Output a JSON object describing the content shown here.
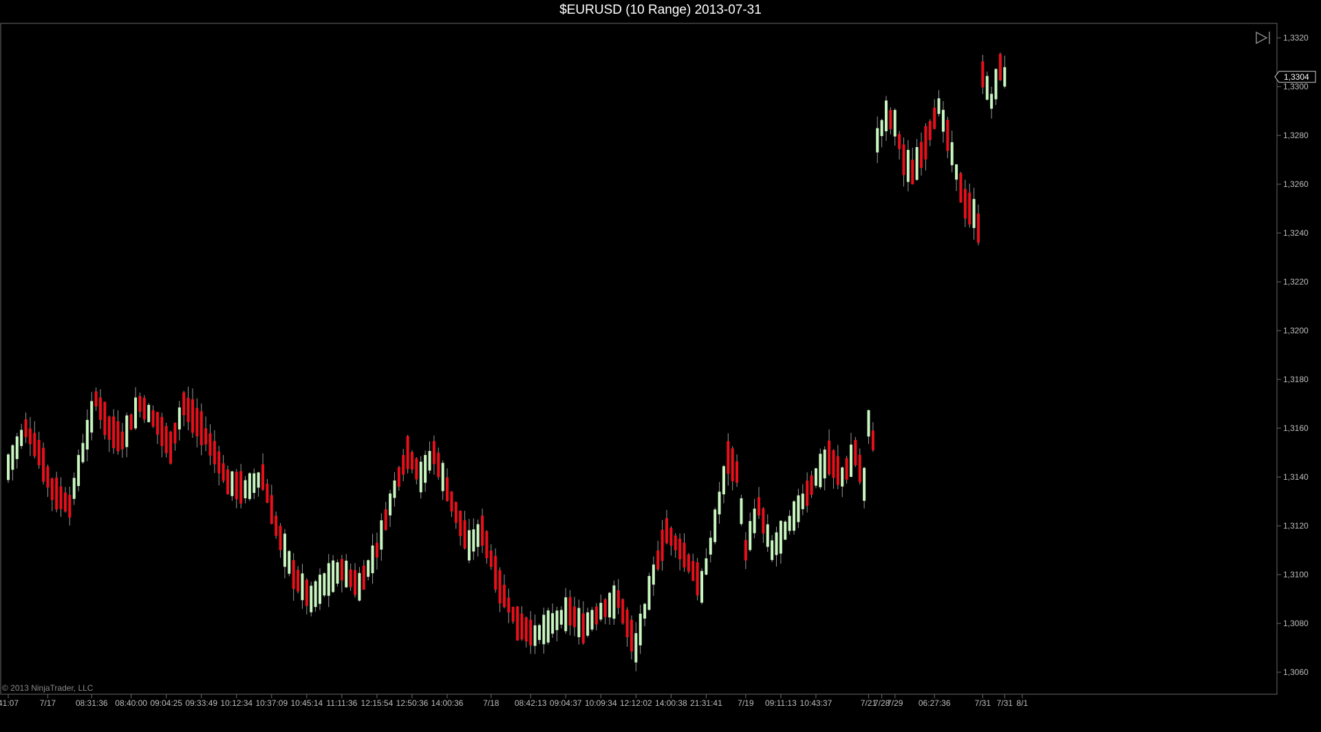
{
  "title": "$EURUSD (10 Range)  2013-07-31",
  "copyright": "© 2013 NinjaTrader, LLC",
  "colors": {
    "background": "#000000",
    "up": "#c8f5c0",
    "down": "#e8101a",
    "wick": "#9a9a9a",
    "axis": "#6a6a6a",
    "text": "#bdbdbd"
  },
  "icons": {
    "scroll_end": "scroll-to-end-icon"
  },
  "chart_data": {
    "type": "candlestick",
    "title": "$EURUSD (10 Range)  2013-07-31",
    "instrument": "$EURUSD",
    "bar_type": "10 Range",
    "date": "2013-07-31",
    "last_price": "1,3304",
    "ylim": [
      1.305,
      1.3325
    ],
    "y_ticks": [
      {
        "value": 1.332,
        "label": "1,3320"
      },
      {
        "value": 1.33,
        "label": "1,3300"
      },
      {
        "value": 1.328,
        "label": "1,3280"
      },
      {
        "value": 1.326,
        "label": "1,3260"
      },
      {
        "value": 1.324,
        "label": "1,3240"
      },
      {
        "value": 1.322,
        "label": "1,3220"
      },
      {
        "value": 1.32,
        "label": "1,3200"
      },
      {
        "value": 1.318,
        "label": "1,3180"
      },
      {
        "value": 1.316,
        "label": "1,3160"
      },
      {
        "value": 1.314,
        "label": "1,3140"
      },
      {
        "value": 1.312,
        "label": "1,3120"
      },
      {
        "value": 1.31,
        "label": "1,3100"
      },
      {
        "value": 1.308,
        "label": "1,3080"
      },
      {
        "value": 1.306,
        "label": "1,3060"
      }
    ],
    "x_ticks": [
      {
        "bar": 0,
        "label": "41:07"
      },
      {
        "bar": 9,
        "label": "7/17"
      },
      {
        "bar": 19,
        "label": "08:31:36"
      },
      {
        "bar": 28,
        "label": "08:40:00"
      },
      {
        "bar": 36,
        "label": "09:04:25"
      },
      {
        "bar": 44,
        "label": "09:33:49"
      },
      {
        "bar": 52,
        "label": "10:12:34"
      },
      {
        "bar": 60,
        "label": "10:37:09"
      },
      {
        "bar": 68,
        "label": "10:45:14"
      },
      {
        "bar": 76,
        "label": "11:11:36"
      },
      {
        "bar": 84,
        "label": "12:15:54"
      },
      {
        "bar": 92,
        "label": "12:50:36"
      },
      {
        "bar": 100,
        "label": "14:00:36"
      },
      {
        "bar": 110,
        "label": "7/18"
      },
      {
        "bar": 119,
        "label": "08:42:13"
      },
      {
        "bar": 127,
        "label": "09:04:37"
      },
      {
        "bar": 135,
        "label": "10:09:34"
      },
      {
        "bar": 143,
        "label": "12:12:02"
      },
      {
        "bar": 151,
        "label": "14:00:38"
      },
      {
        "bar": 159,
        "label": "21:31:41"
      },
      {
        "bar": 168,
        "label": "7/19"
      },
      {
        "bar": 176,
        "label": "09:11:13"
      },
      {
        "bar": 184,
        "label": "10:43:37"
      },
      {
        "bar": 196,
        "label": "7/21"
      },
      {
        "bar": 199,
        "label": "7/28"
      },
      {
        "bar": 202,
        "label": "7/29"
      },
      {
        "bar": 211,
        "label": "06:27:36"
      },
      {
        "bar": 222,
        "label": "7/31"
      },
      {
        "bar": 227,
        "label": "7/31"
      },
      {
        "bar": 231,
        "label": "8/1"
      }
    ],
    "path_anchors": [
      [
        0,
        1.3144
      ],
      [
        4,
        1.316
      ],
      [
        7,
        1.315
      ],
      [
        10,
        1.3135
      ],
      [
        14,
        1.3128
      ],
      [
        17,
        1.315
      ],
      [
        20,
        1.3172
      ],
      [
        23,
        1.316
      ],
      [
        26,
        1.3155
      ],
      [
        30,
        1.317
      ],
      [
        34,
        1.3162
      ],
      [
        37,
        1.3152
      ],
      [
        40,
        1.317
      ],
      [
        44,
        1.316
      ],
      [
        47,
        1.315
      ],
      [
        50,
        1.3138
      ],
      [
        54,
        1.3135
      ],
      [
        58,
        1.314
      ],
      [
        61,
        1.312
      ],
      [
        65,
        1.31
      ],
      [
        69,
        1.309
      ],
      [
        73,
        1.3098
      ],
      [
        76,
        1.3102
      ],
      [
        80,
        1.3095
      ],
      [
        84,
        1.311
      ],
      [
        88,
        1.3135
      ],
      [
        91,
        1.315
      ],
      [
        94,
        1.314
      ],
      [
        97,
        1.315
      ],
      [
        101,
        1.313
      ],
      [
        105,
        1.3112
      ],
      [
        108,
        1.3118
      ],
      [
        112,
        1.3095
      ],
      [
        116,
        1.308
      ],
      [
        120,
        1.3075
      ],
      [
        124,
        1.308
      ],
      [
        128,
        1.3085
      ],
      [
        131,
        1.3078
      ],
      [
        135,
        1.3085
      ],
      [
        139,
        1.309
      ],
      [
        143,
        1.307
      ],
      [
        147,
        1.31
      ],
      [
        150,
        1.3118
      ],
      [
        154,
        1.3108
      ],
      [
        158,
        1.3095
      ],
      [
        161,
        1.312
      ],
      [
        164,
        1.3148
      ],
      [
        166,
        1.3142
      ],
      [
        168,
        1.311
      ],
      [
        171,
        1.3128
      ],
      [
        174,
        1.311
      ],
      [
        177,
        1.3118
      ],
      [
        181,
        1.313
      ],
      [
        184,
        1.314
      ],
      [
        187,
        1.3148
      ],
      [
        190,
        1.314
      ],
      [
        193,
        1.315
      ],
      [
        195,
        1.3137
      ],
      [
        196,
        1.3162
      ],
      [
        197,
        1.3155
      ]
    ],
    "segments": [
      {
        "start_bar": 198,
        "path": [
          [
            198,
            1.3278
          ],
          [
            200,
            1.3288
          ],
          [
            202,
            1.3285
          ],
          [
            204,
            1.327
          ],
          [
            206,
            1.3265
          ],
          [
            208,
            1.3272
          ],
          [
            210,
            1.3282
          ],
          [
            212,
            1.3292
          ],
          [
            214,
            1.328
          ],
          [
            216,
            1.3265
          ],
          [
            218,
            1.3252
          ],
          [
            220,
            1.3248
          ],
          [
            221,
            1.3242
          ]
        ]
      },
      {
        "start_bar": 222,
        "path": [
          [
            222,
            1.3305
          ],
          [
            224,
            1.3294
          ],
          [
            226,
            1.3308
          ],
          [
            227,
            1.3304
          ]
        ]
      }
    ],
    "bar_count": 228
  }
}
